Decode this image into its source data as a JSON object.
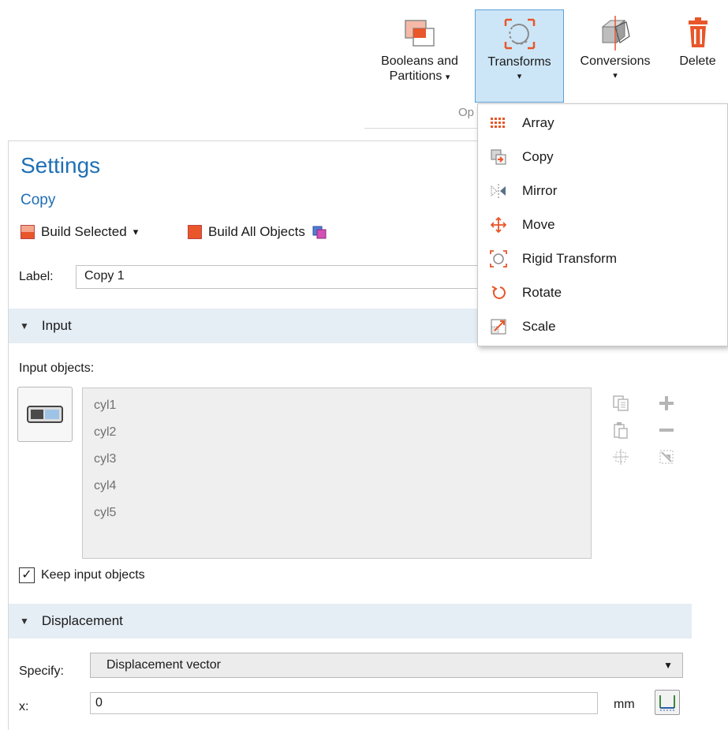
{
  "ribbon": {
    "buttons": [
      {
        "label_line1": "Booleans and",
        "label_line2": "Partitions",
        "icon": "booleans-partitions-icon"
      },
      {
        "label_line1": "Transforms",
        "label_line2": "",
        "icon": "transforms-icon"
      },
      {
        "label_line1": "Conversions",
        "label_line2": "",
        "icon": "conversions-icon"
      },
      {
        "label_line1": "Delete",
        "label_line2": "",
        "icon": "delete-icon"
      }
    ],
    "group_label": "Op",
    "caret": "▾"
  },
  "menu": {
    "items": [
      {
        "label": "Array",
        "icon": "array-icon"
      },
      {
        "label": "Copy",
        "icon": "copy-icon"
      },
      {
        "label": "Mirror",
        "icon": "mirror-icon"
      },
      {
        "label": "Move",
        "icon": "move-icon"
      },
      {
        "label": "Rigid Transform",
        "icon": "rigid-transform-icon"
      },
      {
        "label": "Rotate",
        "icon": "rotate-icon"
      },
      {
        "label": "Scale",
        "icon": "scale-icon"
      }
    ]
  },
  "settings": {
    "title": "Settings",
    "subtitle": "Copy",
    "toolbar": {
      "build_selected": "Build Selected",
      "build_all": "Build All Objects",
      "caret": "▾"
    },
    "label_field": {
      "label": "Label:",
      "value": "Copy 1"
    },
    "input_section": {
      "title": "Input",
      "objects_label": "Input objects:",
      "objects": [
        "cyl1",
        "cyl2",
        "cyl3",
        "cyl4",
        "cyl5"
      ],
      "keep_label": "Keep input objects",
      "keep_checked": true,
      "check_mark": "✓"
    },
    "displacement_section": {
      "title": "Displacement",
      "specify_label": "Specify:",
      "specify_value": "Displacement vector",
      "x_label": "x:",
      "x_value": "0",
      "unit": "mm"
    },
    "section_caret": "▼"
  },
  "colors": {
    "accent": "#1f6fb5",
    "selected_button_bg": "#cde6f7",
    "section_bg": "#e5edf5",
    "icon_orange": "#e8562a"
  }
}
